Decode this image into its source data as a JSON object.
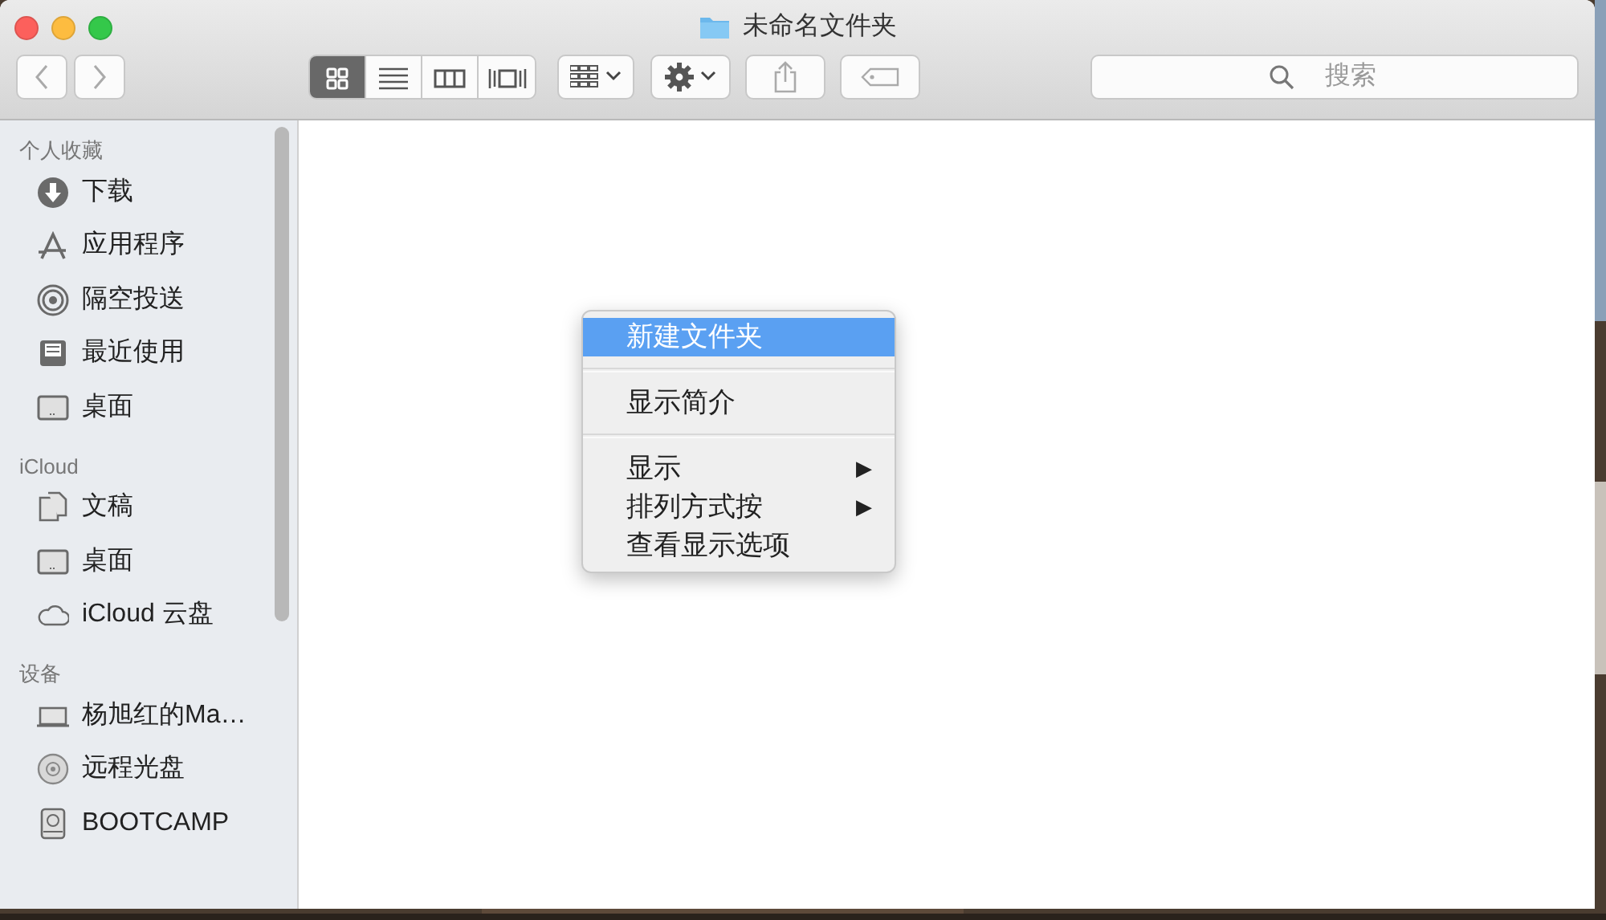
{
  "window": {
    "title": "未命名文件夹"
  },
  "toolbar": {
    "view_modes": [
      {
        "selected": true
      },
      {
        "selected": false
      },
      {
        "selected": false
      },
      {
        "selected": false
      }
    ],
    "search": {
      "placeholder": "搜索"
    }
  },
  "sidebar": {
    "sections": [
      {
        "title": "个人收藏",
        "items": [
          {
            "label": "下载"
          },
          {
            "label": "应用程序"
          },
          {
            "label": "隔空投送"
          },
          {
            "label": "最近使用"
          },
          {
            "label": "桌面"
          }
        ]
      },
      {
        "title": "iCloud",
        "items": [
          {
            "label": "文稿"
          },
          {
            "label": "桌面"
          },
          {
            "label": "iCloud 云盘"
          }
        ]
      },
      {
        "title": "设备",
        "items": [
          {
            "label": "杨旭红的Ma…"
          },
          {
            "label": "远程光盘"
          },
          {
            "label": "BOOTCAMP"
          }
        ]
      }
    ]
  },
  "context_menu": {
    "items": [
      {
        "kind": "item",
        "label": "新建文件夹",
        "selected": true
      },
      {
        "kind": "separator"
      },
      {
        "kind": "item",
        "label": "显示简介",
        "selected": false
      },
      {
        "kind": "separator"
      },
      {
        "kind": "item",
        "label": "显示",
        "selected": false,
        "arrow": "▶"
      },
      {
        "kind": "item",
        "label": "排列方式按",
        "selected": false,
        "arrow": "▶"
      },
      {
        "kind": "item",
        "label": "查看显示选项",
        "selected": false
      }
    ]
  }
}
